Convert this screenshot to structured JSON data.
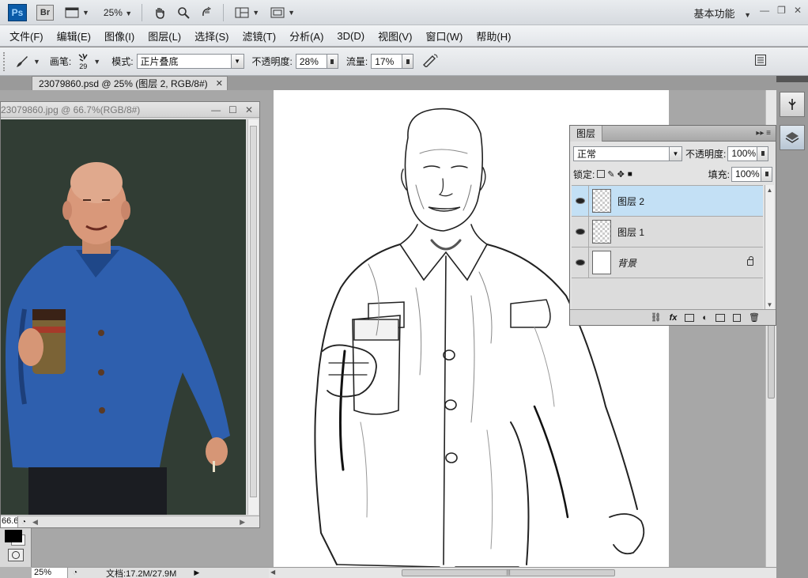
{
  "appbar": {
    "ps_logo": "Ps",
    "br_logo": "Br",
    "zoom": "25%",
    "workspace": "基本功能"
  },
  "menu": {
    "items": [
      "文件(F)",
      "编辑(E)",
      "图像(I)",
      "图层(L)",
      "选择(S)",
      "滤镜(T)",
      "分析(A)",
      "3D(D)",
      "视图(V)",
      "窗口(W)",
      "帮助(H)"
    ]
  },
  "options": {
    "brush_label": "画笔:",
    "brush_size": "29",
    "mode_label": "模式:",
    "mode_value": "正片叠底",
    "opacity_label": "不透明度:",
    "opacity_value": "28%",
    "flow_label": "流量:",
    "flow_value": "17%"
  },
  "document": {
    "tab_title": "23079860.psd @ 25% (图层 2, RGB/8#)",
    "status_zoom": "25%",
    "status_doc": "文档:17.2M/27.9M"
  },
  "photo_window": {
    "title": "23079860.jpg @ 66.7%(RGB/8#)",
    "zoom": "66.67%"
  },
  "layers_panel": {
    "tab": "图层",
    "blend_mode": "正常",
    "opacity_label": "不透明度:",
    "opacity_value": "100%",
    "lock_label": "锁定:",
    "fill_label": "填充:",
    "fill_value": "100%",
    "layers": [
      {
        "name": "图层 2",
        "selected": true,
        "transparent": true
      },
      {
        "name": "图层 1",
        "selected": false,
        "transparent": true
      },
      {
        "name": "背景",
        "selected": false,
        "transparent": false,
        "locked": true
      }
    ]
  },
  "colors": {
    "jacket": "#2e5fae",
    "backdrop": "#2c3830",
    "selection": "#c3e0f5",
    "ps_blue": "#0b5ba8"
  }
}
